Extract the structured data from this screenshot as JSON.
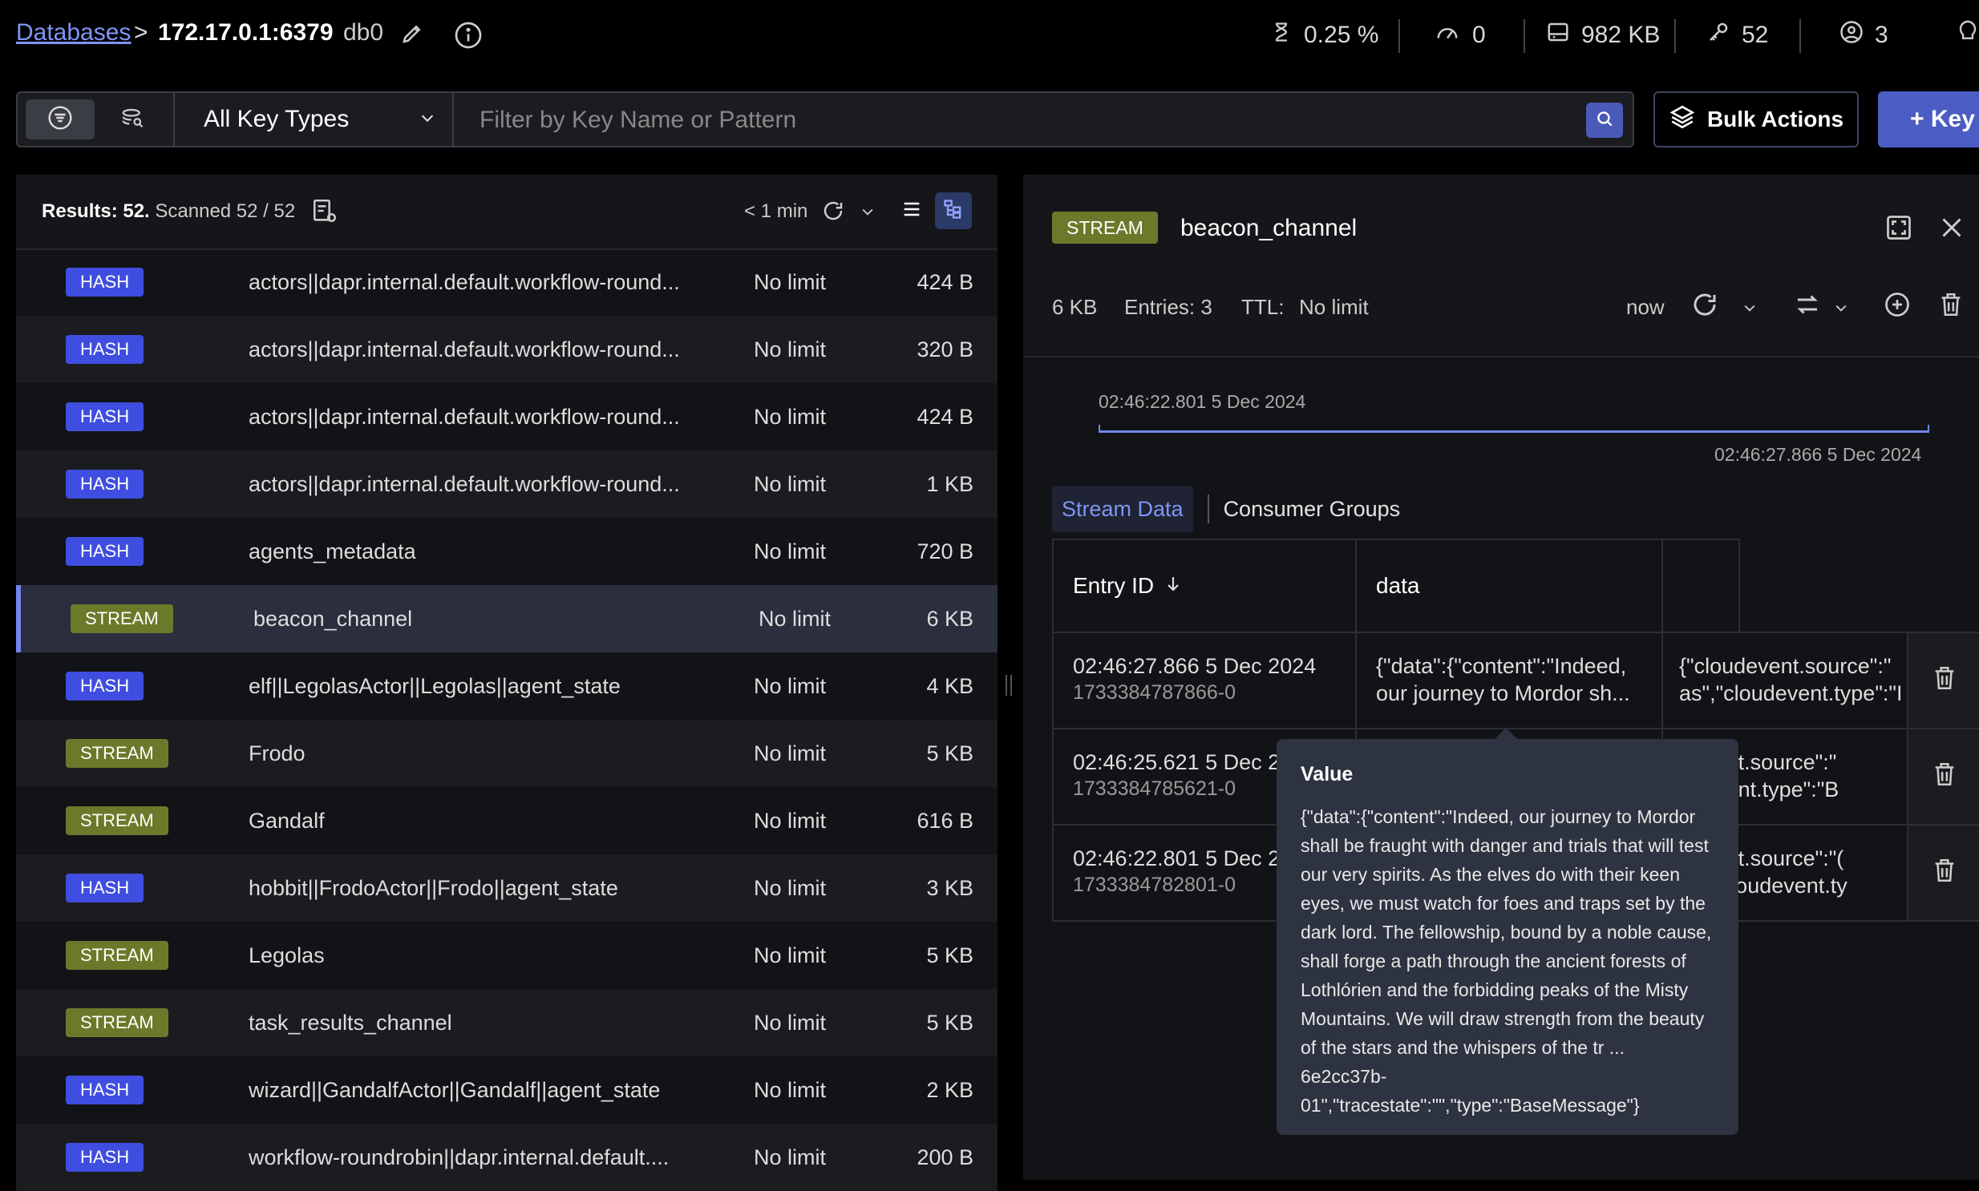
{
  "header": {
    "breadcrumb_link": "Databases",
    "breadcrumb_sep": ">",
    "host": "172.17.0.1:6379",
    "db": "db0",
    "stats": {
      "cpu": "0.25 %",
      "ops": "0",
      "memory": "982 KB",
      "keys": "52",
      "clients": "3"
    }
  },
  "filter": {
    "key_type": "All Key Types",
    "placeholder": "Filter by Key Name or Pattern",
    "bulk_actions": "Bulk Actions",
    "add_key": "+ Key"
  },
  "list": {
    "results_label": "Results: 52.",
    "scanned": "Scanned 52 / 52",
    "refresh_ago": "< 1 min",
    "rows": [
      {
        "type": "HASH",
        "key": "actors||dapr.internal.default.workflow-round...",
        "ttl": "No limit",
        "size": "424 B"
      },
      {
        "type": "HASH",
        "key": "actors||dapr.internal.default.workflow-round...",
        "ttl": "No limit",
        "size": "320 B"
      },
      {
        "type": "HASH",
        "key": "actors||dapr.internal.default.workflow-round...",
        "ttl": "No limit",
        "size": "424 B"
      },
      {
        "type": "HASH",
        "key": "actors||dapr.internal.default.workflow-round...",
        "ttl": "No limit",
        "size": "1 KB"
      },
      {
        "type": "HASH",
        "key": "agents_metadata",
        "ttl": "No limit",
        "size": "720 B"
      },
      {
        "type": "STREAM",
        "key": "beacon_channel",
        "ttl": "No limit",
        "size": "6 KB"
      },
      {
        "type": "HASH",
        "key": "elf||LegolasActor||Legolas||agent_state",
        "ttl": "No limit",
        "size": "4 KB"
      },
      {
        "type": "STREAM",
        "key": "Frodo",
        "ttl": "No limit",
        "size": "5 KB"
      },
      {
        "type": "STREAM",
        "key": "Gandalf",
        "ttl": "No limit",
        "size": "616 B"
      },
      {
        "type": "HASH",
        "key": "hobbit||FrodoActor||Frodo||agent_state",
        "ttl": "No limit",
        "size": "3 KB"
      },
      {
        "type": "STREAM",
        "key": "Legolas",
        "ttl": "No limit",
        "size": "5 KB"
      },
      {
        "type": "STREAM",
        "key": "task_results_channel",
        "ttl": "No limit",
        "size": "5 KB"
      },
      {
        "type": "HASH",
        "key": "wizard||GandalfActor||Gandalf||agent_state",
        "ttl": "No limit",
        "size": "2 KB"
      },
      {
        "type": "HASH",
        "key": "workflow-roundrobin||dapr.internal.default....",
        "ttl": "No limit",
        "size": "200 B"
      }
    ]
  },
  "detail": {
    "type": "STREAM",
    "key": "beacon_channel",
    "size": "6 KB",
    "entries": "Entries: 3",
    "ttl_label": "TTL:",
    "ttl_value": "No limit",
    "refreshed": "now",
    "timeline_start": "02:46:22.801 5 Dec 2024",
    "timeline_end": "02:46:27.866 5 Dec 2024",
    "tabs": [
      "Stream Data",
      "Consumer Groups"
    ],
    "columns": [
      "Entry ID",
      "data"
    ],
    "entries_rows": [
      {
        "time": "02:46:27.866 5 Dec 2024",
        "id": "1733384787866-0",
        "data_l1": "{\"data\":{\"content\":\"Indeed,",
        "data_l2": "our journey to Mordor sh...",
        "meta_l1": "{\"cloudevent.source\":\"",
        "meta_l2": "as\",\"cloudevent.type\":\"I"
      },
      {
        "time": "02:46:25.621 5 Dec 20",
        "id": "1733384785621-0",
        "data_l1": "",
        "data_l2": "",
        "meta_l1": "devent.source\":\"",
        "meta_l2": "udevent.type\":\"B"
      },
      {
        "time": "02:46:22.801 5 Dec 20",
        "id": "1733384782801-0",
        "data_l1": "",
        "data_l2": "",
        "meta_l1": "devent.source\":\"(",
        "meta_l2": "or\",\"cloudevent.ty"
      }
    ]
  },
  "tooltip": {
    "title": "Value",
    "body": "{\"data\":{\"content\":\"Indeed, our journey to Mordor shall be fraught with danger and trials that will test our very spirits. As the elves do with their keen eyes, we must watch for foes and traps set by the dark lord. The fellowship, bound by a noble cause, shall forge a path through the ancient forests of Lothlórien and the forbidding peaks of the Misty Mountains. We will draw strength from the beauty of the stars and the whispers of the tr ... 6e2cc37b-01\",\"tracestate\":\"\",\"type\":\"BaseMessage\"}"
  }
}
